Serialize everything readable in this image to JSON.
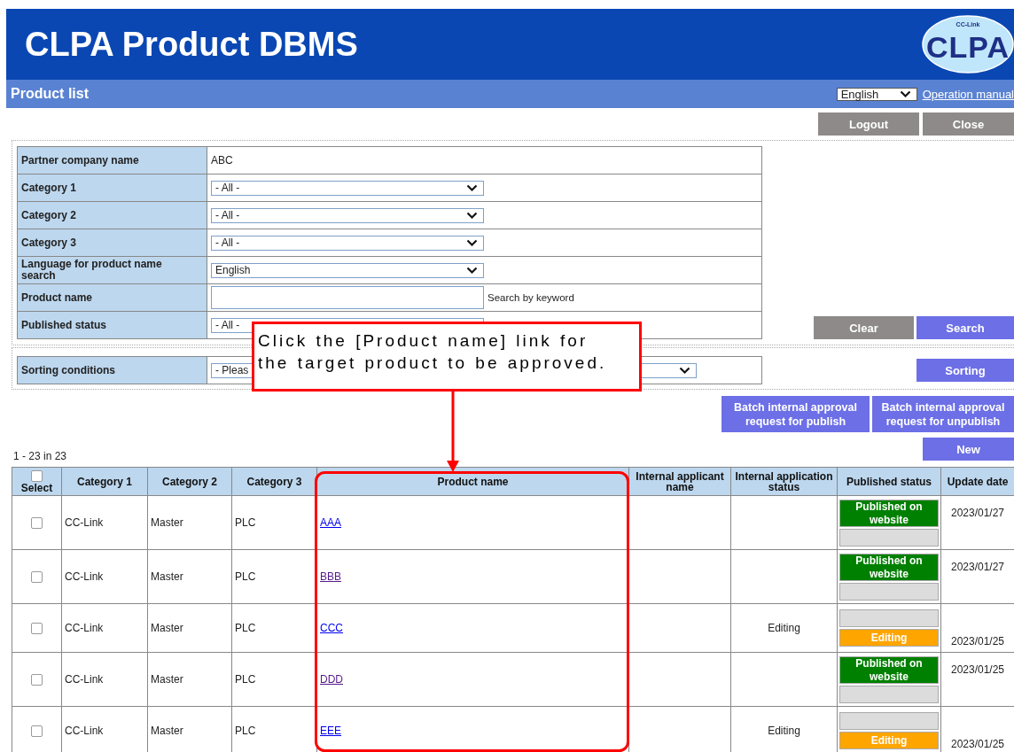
{
  "header": {
    "title": "CLPA Product DBMS",
    "logo": {
      "text": "CLPA",
      "ring_text": "CC-Link"
    }
  },
  "subheader": {
    "title": "Product list",
    "language_select": "English",
    "manual_link": "Operation manual"
  },
  "top_buttons": [
    {
      "label": "Logout",
      "kind": "gray"
    },
    {
      "label": "Close",
      "kind": "gray"
    }
  ],
  "search_form": {
    "rows": [
      {
        "label": "Partner company name",
        "kind": "text",
        "value": "ABC"
      },
      {
        "label": "Category 1",
        "kind": "select",
        "value": "- All -"
      },
      {
        "label": "Category 2",
        "kind": "select",
        "value": "- All -"
      },
      {
        "label": "Category 3",
        "kind": "select",
        "value": "- All -"
      },
      {
        "label": "Language for product name search",
        "kind": "select",
        "value": "English"
      },
      {
        "label": "Product name",
        "kind": "input",
        "note": "Search by keyword"
      },
      {
        "label": "Published status",
        "kind": "select",
        "value": "- All -"
      }
    ],
    "buttons": [
      {
        "label": "Clear",
        "kind": "gray"
      },
      {
        "label": "Search",
        "kind": "blue"
      }
    ]
  },
  "sort_form": {
    "label": "Sorting conditions",
    "value": "- Pleas",
    "button": {
      "label": "Sorting",
      "kind": "blue"
    }
  },
  "batch_buttons": [
    {
      "label": "Batch internal approval request for publish",
      "kind": "blue"
    },
    {
      "label": "Batch internal approval request for unpublish",
      "kind": "blue"
    }
  ],
  "new_button": {
    "label": "New",
    "kind": "blue"
  },
  "result_count": "1 - 23 in 23",
  "table": {
    "select_all": {
      "label": "Select",
      "checked": false
    },
    "columns": [
      "Category 1",
      "Category 2",
      "Category 3",
      "Product name",
      "Internal applicant name",
      "Internal application status",
      "Published status",
      "Update date"
    ],
    "rows": [
      {
        "checked": false,
        "category_1": "CC-Link",
        "category_2": "Master",
        "category_3": "PLC",
        "product_name": "AAA",
        "visited": false,
        "application_status": null,
        "status_slots": [
          {
            "kind": "published",
            "label": "Published on website"
          },
          {
            "kind": "empty"
          }
        ],
        "update_date": "2023/01/27"
      },
      {
        "checked": false,
        "category_1": "CC-Link",
        "category_2": "Master",
        "category_3": "PLC",
        "product_name": "BBB",
        "visited": true,
        "application_status": null,
        "status_slots": [
          {
            "kind": "published",
            "label": "Published on website"
          },
          {
            "kind": "empty"
          }
        ],
        "update_date": "2023/01/27"
      },
      {
        "checked": false,
        "category_1": "CC-Link",
        "category_2": "Master",
        "category_3": "PLC",
        "product_name": "CCC",
        "visited": false,
        "application_status": "Editing",
        "status_slots": [
          {
            "kind": "empty"
          },
          {
            "kind": "editing",
            "label": "Editing"
          }
        ],
        "update_date": "2023/01/25"
      },
      {
        "checked": false,
        "category_1": "CC-Link",
        "category_2": "Master",
        "category_3": "PLC",
        "product_name": "DDD",
        "visited": true,
        "application_status": null,
        "status_slots": [
          {
            "kind": "published",
            "label": "Published on website"
          },
          {
            "kind": "empty"
          }
        ],
        "update_date": "2023/01/25"
      },
      {
        "checked": false,
        "category_1": "CC-Link",
        "category_2": "Master",
        "category_3": "PLC",
        "product_name": "EEE",
        "visited": false,
        "application_status": "Editing",
        "status_slots": [
          {
            "kind": "empty"
          },
          {
            "kind": "editing",
            "label": "Editing"
          }
        ],
        "update_date": "2023/01/25"
      }
    ]
  },
  "callout": {
    "text": "Click the [Product name] link for the target product to be approved."
  }
}
